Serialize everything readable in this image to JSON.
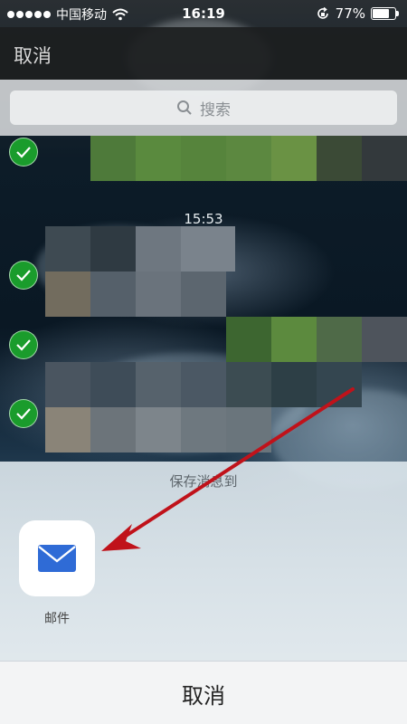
{
  "status_bar": {
    "carrier": "中国移动",
    "time": "16:19",
    "battery": "77%",
    "battery_level": 0.77
  },
  "nav": {
    "cancel_label": "取消"
  },
  "search": {
    "placeholder": "搜索"
  },
  "chat": {
    "time_divider": "15:53"
  },
  "share_sheet": {
    "title": "保存消息到",
    "items": [
      {
        "label": "邮件",
        "icon": "mail-icon"
      }
    ],
    "cancel_label": "取消"
  },
  "colors": {
    "check_green": "#1a9c2c",
    "mail_blue": "#2f6bd6",
    "annotation_arrow": "#c0121a"
  }
}
